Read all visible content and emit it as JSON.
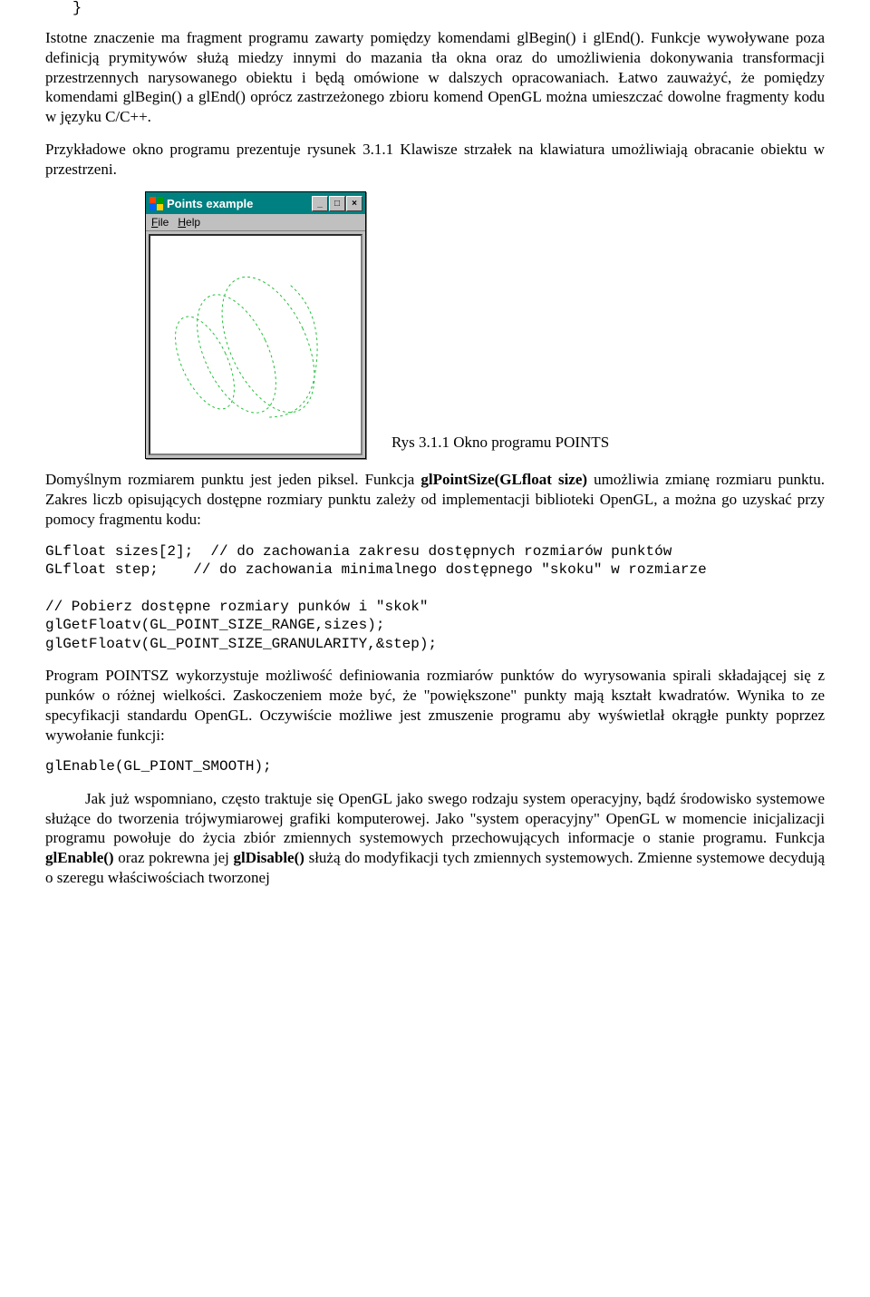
{
  "code_scrap": "}",
  "para1": "Istotne znaczenie ma fragment programu zawarty pomiędzy komendami glBegin() i glEnd(). Funkcje wywoływane poza definicją prymitywów służą miedzy innymi do mazania tła okna oraz do umożliwienia dokonywania transformacji przestrzennych narysowanego obiektu i będą omówione w dalszych opracowaniach. Łatwo zauważyć, że pomiędzy komendami glBegin() a glEnd() oprócz zastrzeżonego zbioru komend OpenGL można umieszczać dowolne fragmenty kodu w języku C/C++.",
  "para1b": "Przykładowe okno programu prezentuje rysunek 3.1.1 Klawisze strzałek na klawiatura umożliwiają obracanie obiektu w przestrzeni.",
  "window": {
    "title": "Points example",
    "menu_file": "File",
    "menu_help": "Help"
  },
  "caption": "Rys 3.1.1 Okno programu POINTS",
  "para2a": "Domyślnym rozmiarem punktu jest jeden piksel. Funkcja ",
  "para2b": "glPointSize(GLfloat size)",
  "para2c": " umożliwia zmianę rozmiaru punktu. Zakres liczb opisujących dostępne rozmiary punktu zależy od implementacji biblioteki OpenGL, a można go uzyskać przy pomocy fragmentu kodu:",
  "code1": "GLfloat sizes[2];  // do zachowania zakresu dostępnych rozmiarów punktów\nGLfloat step;    // do zachowania minimalnego dostępnego \"skoku\" w rozmiarze\n\n// Pobierz dostępne rozmiary punków i \"skok\"\nglGetFloatv(GL_POINT_SIZE_RANGE,sizes);\nglGetFloatv(GL_POINT_SIZE_GRANULARITY,&step);",
  "para3": "Program POINTSZ wykorzystuje możliwość definiowania rozmiarów punktów do wyrysowania spirali składającej się z punków o różnej wielkości. Zaskoczeniem może być, że \"powiększone\" punkty mają kształt kwadratów. Wynika to ze specyfikacji standardu OpenGL. Oczywiście możliwe jest zmuszenie programu aby wyświetlał okrągłe punkty poprzez wywołanie funkcji:",
  "code2": "glEnable(GL_PIONT_SMOOTH);",
  "para4a": "Jak już wspomniano, często traktuje się OpenGL jako swego rodzaju system operacyjny, bądź środowisko systemowe służące do tworzenia trójwymiarowej grafiki komputerowej. Jako \"system operacyjny\" OpenGL w momencie inicjalizacji programu powołuje do życia zbiór zmiennych systemowych przechowujących informacje o stanie programu. Funkcja ",
  "para4b": "glEnable()",
  "para4c": " oraz pokrewna jej ",
  "para4d": "glDisable()",
  "para4e": " służą do modyfikacji tych zmiennych systemowych. Zmienne systemowe decydują o szeregu właściwościach tworzonej"
}
